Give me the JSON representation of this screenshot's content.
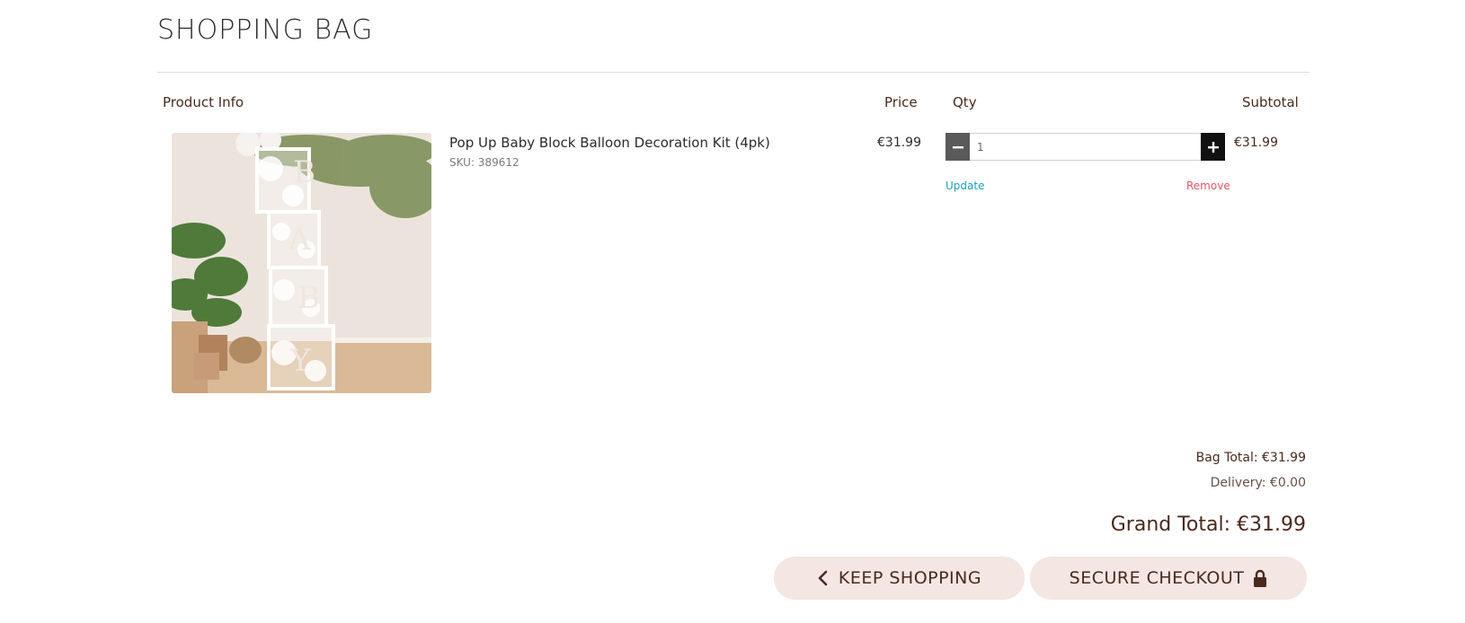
{
  "page": {
    "title": "SHOPPING BAG"
  },
  "table": {
    "headers": {
      "product": "Product Info",
      "price": "Price",
      "qty": "Qty",
      "subtotal": "Subtotal"
    }
  },
  "item": {
    "name": "Pop Up Baby Block Balloon Decoration Kit (4pk)",
    "sku": "SKU: 389612",
    "price": "€31.99",
    "qty": "1",
    "subtotal": "€31.99",
    "minus_icon": "minus-icon",
    "plus_icon": "plus-icon",
    "update_label": "Update",
    "remove_label": "Remove"
  },
  "totals": {
    "bag_total": "Bag Total: €31.99",
    "delivery": "Delivery: €0.00",
    "grand_total": "Grand Total: €31.99"
  },
  "actions": {
    "keep_shopping": "KEEP SHOPPING",
    "secure_checkout": "SECURE CHECKOUT",
    "keep_icon": "chevron-left-icon",
    "secure_icon": "lock-icon"
  },
  "colors": {
    "text_brown": "#4a2a1e",
    "button_bg": "#f3e6e3",
    "update": "#1aa3b8",
    "remove": "#e05565"
  }
}
